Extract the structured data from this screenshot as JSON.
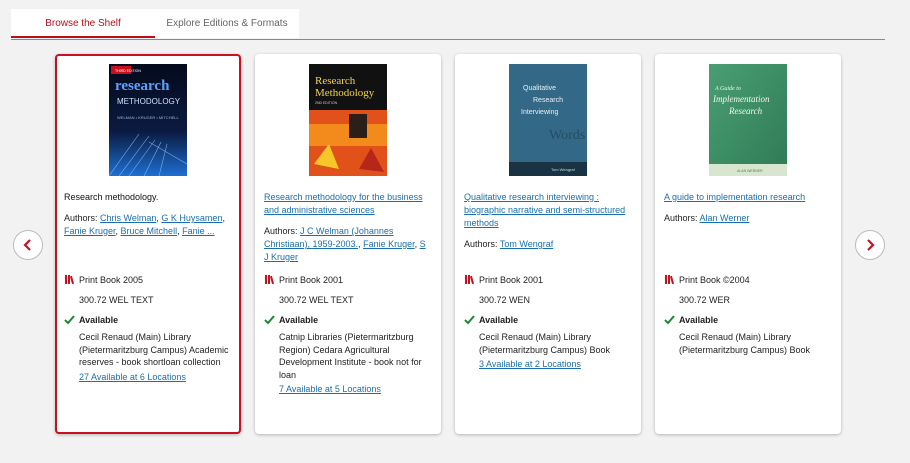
{
  "tabs": {
    "browse": "Browse the Shelf",
    "explore": "Explore Editions & Formats"
  },
  "colors": {
    "accent": "#c8101e",
    "link": "#1a6faa",
    "available": "#1e8a2e"
  },
  "cards": [
    {
      "title": "Research methodology.",
      "authors_label": "Authors:",
      "authors": [
        "Chris Welman",
        "G K Huysamen",
        "Fanie Kruger",
        "Bruce Mitchell",
        "Fanie ..."
      ],
      "format": "Print Book 2005",
      "call_number": "300.72 WEL TEXT",
      "status": "Available",
      "location": "Cecil Renaud (Main) Library (Pietermaritzburg Campus) Academic reserves - book shortloan collection",
      "availability_link": "27 Available at 6 Locations",
      "cover": {
        "top_text": "research",
        "sub_text": "METHODOLOGY",
        "names": "WELMAN • KRUGER • MITCHELL",
        "edition": "THIRD EDITION"
      }
    },
    {
      "title": "Research methodology for the business and administrative sciences",
      "authors_label": "Authors:",
      "authors": [
        "J C Welman (Johannes Christiaan), 1959-2003.",
        "Fanie Kruger",
        "S J Kruger"
      ],
      "format": "Print Book 2001",
      "call_number": "300.72 WEL TEXT",
      "status": "Available",
      "location": "Catnip Libraries (Pietermaritzburg Region) Cedara Agricultural Development Institute - book not for loan",
      "availability_link": "7 Available at 5 Locations",
      "cover": {
        "line1": "Research",
        "line2": "Methodology",
        "edition": "2ND EDITION"
      }
    },
    {
      "title": "Qualitative research interviewing : biographic narrative and semi-structured methods",
      "authors_label": "Authors:",
      "authors": [
        "Tom Wengraf"
      ],
      "format": "Print Book 2001",
      "call_number": "300.72 WEN",
      "status": "Available",
      "location": "Cecil Renaud (Main) Library (Pietermaritzburg Campus) Book",
      "availability_link": "3 Available at 2 Locations",
      "cover": {
        "line1": "Qualitative",
        "line2": "Research",
        "line3": "Interviewing",
        "author": "Tom Wengraf"
      }
    },
    {
      "title": "A guide to implementation research",
      "authors_label": "Authors:",
      "authors": [
        "Alan Werner"
      ],
      "format": "Print Book ©2004",
      "call_number": "300.72 WER",
      "status": "Available",
      "location": "Cecil Renaud (Main) Library (Pietermaritzburg Campus) Book",
      "availability_link": "",
      "cover": {
        "line1": "A Guide to",
        "line2": "Implementation",
        "line3": "Research",
        "author": "ALAN WERNER"
      }
    }
  ]
}
